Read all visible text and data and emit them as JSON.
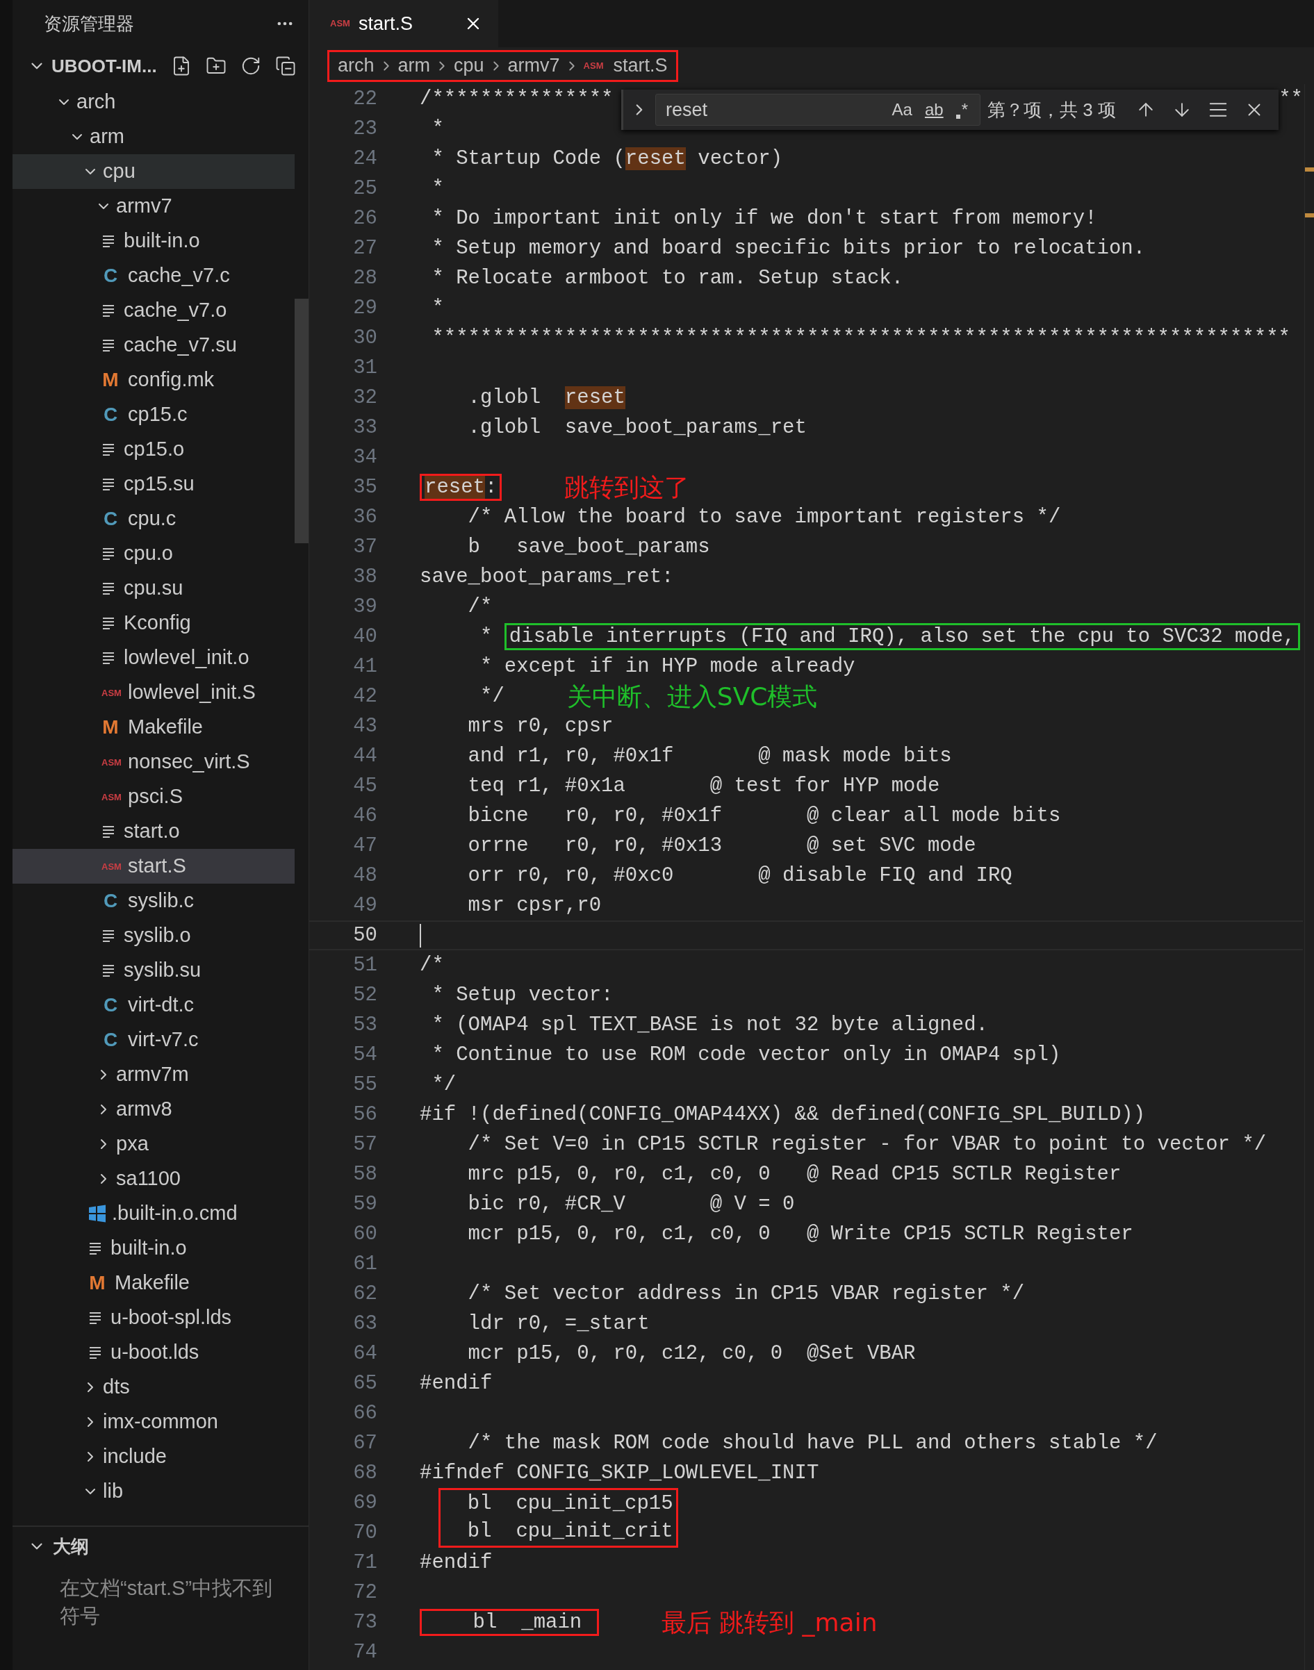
{
  "sidebar": {
    "title": "资源管理器",
    "root": {
      "name": "UBOOT-IM...",
      "expanded": true
    },
    "tree": [
      {
        "name": "arch",
        "kind": "folder",
        "expanded": true,
        "selected": false,
        "children": [
          {
            "name": "arm",
            "kind": "folder",
            "expanded": true,
            "selected": false,
            "children": [
              {
                "name": "cpu",
                "kind": "folder",
                "expanded": true,
                "selected": true,
                "children": [
                  {
                    "name": "armv7",
                    "kind": "folder",
                    "expanded": true,
                    "selected": false,
                    "children": [
                      {
                        "name": "built-in.o",
                        "kind": "text",
                        "selected": false
                      },
                      {
                        "name": "cache_v7.c",
                        "kind": "c",
                        "icon": "C",
                        "selected": false
                      },
                      {
                        "name": "cache_v7.o",
                        "kind": "text",
                        "selected": false
                      },
                      {
                        "name": "cache_v7.su",
                        "kind": "text",
                        "selected": false
                      },
                      {
                        "name": "config.mk",
                        "kind": "make",
                        "icon": "M",
                        "selected": false
                      },
                      {
                        "name": "cp15.c",
                        "kind": "c",
                        "icon": "C",
                        "selected": false
                      },
                      {
                        "name": "cp15.o",
                        "kind": "text",
                        "selected": false
                      },
                      {
                        "name": "cp15.su",
                        "kind": "text",
                        "selected": false
                      },
                      {
                        "name": "cpu.c",
                        "kind": "c",
                        "icon": "C",
                        "selected": false
                      },
                      {
                        "name": "cpu.o",
                        "kind": "text",
                        "selected": false
                      },
                      {
                        "name": "cpu.su",
                        "kind": "text",
                        "selected": false
                      },
                      {
                        "name": "Kconfig",
                        "kind": "text",
                        "selected": false
                      },
                      {
                        "name": "lowlevel_init.o",
                        "kind": "text",
                        "selected": false
                      },
                      {
                        "name": "lowlevel_init.S",
                        "kind": "asm",
                        "icon": "ASM",
                        "selected": false
                      },
                      {
                        "name": "Makefile",
                        "kind": "make",
                        "icon": "M",
                        "selected": false
                      },
                      {
                        "name": "nonsec_virt.S",
                        "kind": "asm",
                        "icon": "ASM",
                        "selected": false
                      },
                      {
                        "name": "psci.S",
                        "kind": "asm",
                        "icon": "ASM",
                        "selected": false
                      },
                      {
                        "name": "start.o",
                        "kind": "text",
                        "selected": false
                      },
                      {
                        "name": "start.S",
                        "kind": "asm",
                        "icon": "ASM",
                        "selected": true
                      },
                      {
                        "name": "syslib.c",
                        "kind": "c",
                        "icon": "C",
                        "selected": false
                      },
                      {
                        "name": "syslib.o",
                        "kind": "text",
                        "selected": false
                      },
                      {
                        "name": "syslib.su",
                        "kind": "text",
                        "selected": false
                      },
                      {
                        "name": "virt-dt.c",
                        "kind": "c",
                        "icon": "C",
                        "selected": false
                      },
                      {
                        "name": "virt-v7.c",
                        "kind": "c",
                        "icon": "C",
                        "selected": false
                      }
                    ]
                  },
                  {
                    "name": "armv7m",
                    "kind": "folder",
                    "expanded": false,
                    "selected": false
                  },
                  {
                    "name": "armv8",
                    "kind": "folder",
                    "expanded": false,
                    "selected": false
                  },
                  {
                    "name": "pxa",
                    "kind": "folder",
                    "expanded": false,
                    "selected": false
                  },
                  {
                    "name": "sa1100",
                    "kind": "folder",
                    "expanded": false,
                    "selected": false
                  },
                  {
                    "name": ".built-in.o.cmd",
                    "kind": "windows",
                    "selected": false
                  },
                  {
                    "name": "built-in.o",
                    "kind": "text",
                    "selected": false
                  },
                  {
                    "name": "Makefile",
                    "kind": "make",
                    "icon": "M",
                    "selected": false
                  },
                  {
                    "name": "u-boot-spl.lds",
                    "kind": "text",
                    "selected": false
                  },
                  {
                    "name": "u-boot.lds",
                    "kind": "text",
                    "selected": false
                  }
                ]
              },
              {
                "name": "dts",
                "kind": "folder",
                "expanded": false,
                "selected": false
              },
              {
                "name": "imx-common",
                "kind": "folder",
                "expanded": false,
                "selected": false
              },
              {
                "name": "include",
                "kind": "folder",
                "expanded": false,
                "selected": false
              },
              {
                "name": "lib",
                "kind": "folder",
                "expanded": true,
                "selected": false
              }
            ]
          }
        ]
      }
    ],
    "outline": {
      "title": "大纲",
      "expanded": true,
      "message": "在文档“start.S”中找不到符号"
    }
  },
  "tabs": [
    {
      "title": "start.S",
      "icon": "ASM",
      "selected": true
    }
  ],
  "breadcrumb": {
    "color": "#f21b1b",
    "items": [
      {
        "text": "arch"
      },
      {
        "text": "arm"
      },
      {
        "text": "cpu"
      },
      {
        "text": "armv7"
      },
      {
        "text": "start.S",
        "icon": "ASM"
      }
    ]
  },
  "find": {
    "query": "reset",
    "options": [
      {
        "label": "Aa",
        "kind": "case",
        "on": false
      },
      {
        "label": "ab",
        "kind": "word",
        "on": false
      },
      {
        "label": "*",
        "kind": "regex",
        "on": false
      }
    ],
    "result": "第？项，共 3 项"
  },
  "code": [
    {
      "number": "22",
      "current": false,
      "segments": [
        {
          "kind": "text",
          "text": "/***************"
        }
      ],
      "tail": "**"
    },
    {
      "number": "23",
      "current": false,
      "segments": [
        {
          "kind": "text",
          "text": " *"
        }
      ]
    },
    {
      "number": "24",
      "current": false,
      "segments": [
        {
          "kind": "text",
          "text": " * Startup Code ("
        },
        {
          "kind": "match",
          "text": "reset"
        },
        {
          "kind": "text",
          "text": " vector)"
        }
      ]
    },
    {
      "number": "25",
      "current": false,
      "segments": [
        {
          "kind": "text",
          "text": " *"
        }
      ]
    },
    {
      "number": "26",
      "current": false,
      "segments": [
        {
          "kind": "text",
          "text": " * Do important init only if we don't start from memory!"
        }
      ]
    },
    {
      "number": "27",
      "current": false,
      "segments": [
        {
          "kind": "text",
          "text": " * Setup memory and board specific bits prior to relocation."
        }
      ]
    },
    {
      "number": "28",
      "current": false,
      "segments": [
        {
          "kind": "text",
          "text": " * Relocate armboot to ram. Setup stack."
        }
      ]
    },
    {
      "number": "29",
      "current": false,
      "segments": [
        {
          "kind": "text",
          "text": " *"
        }
      ]
    },
    {
      "number": "30",
      "current": false,
      "segments": [
        {
          "kind": "text",
          "text": " ***********************************************************************"
        }
      ]
    },
    {
      "number": "31",
      "current": false
    },
    {
      "number": "32",
      "current": false,
      "segments": [
        {
          "kind": "text",
          "text": "    .globl  "
        },
        {
          "kind": "match",
          "text": "reset"
        }
      ]
    },
    {
      "number": "33",
      "current": false,
      "segments": [
        {
          "kind": "text",
          "text": "    .globl  save_boot_params_ret"
        }
      ]
    },
    {
      "number": "34",
      "current": false
    },
    {
      "number": "35",
      "current": false,
      "segments": [
        {
          "kind": "box",
          "color": "#f21b1b",
          "segments": [
            {
              "kind": "match",
              "text": "reset"
            },
            {
              "kind": "text",
              "text": ":"
            }
          ]
        }
      ],
      "note": {
        "text": "跳转到这了",
        "color": "#f21b1b"
      }
    },
    {
      "number": "36",
      "current": false,
      "segments": [
        {
          "kind": "text",
          "text": "    /* Allow the board to save important registers */"
        }
      ]
    },
    {
      "number": "37",
      "current": false,
      "segments": [
        {
          "kind": "text",
          "text": "    b   save_boot_params"
        }
      ]
    },
    {
      "number": "38",
      "current": false,
      "segments": [
        {
          "kind": "text",
          "text": "save_boot_params_ret:"
        }
      ]
    },
    {
      "number": "39",
      "current": false,
      "segments": [
        {
          "kind": "text",
          "text": "    /*"
        }
      ]
    },
    {
      "number": "40",
      "current": false,
      "segments": [
        {
          "kind": "text",
          "text": "     * "
        },
        {
          "kind": "box",
          "color": "#1fbf2a",
          "segments": [
            {
              "kind": "text",
              "text": "disable interrupts (FIQ and IRQ), also set the cpu to SVC32 mode,"
            }
          ]
        }
      ]
    },
    {
      "number": "41",
      "current": false,
      "segments": [
        {
          "kind": "text",
          "text": "     * except if in HYP mode already"
        }
      ]
    },
    {
      "number": "42",
      "current": false,
      "segments": [
        {
          "kind": "text",
          "text": "     */"
        }
      ],
      "note": {
        "text": "关中断、进入SVC模式",
        "color": "#1fbf2a"
      }
    },
    {
      "number": "43",
      "current": false,
      "segments": [
        {
          "kind": "text",
          "text": "    mrs r0, cpsr"
        }
      ]
    },
    {
      "number": "44",
      "current": false,
      "segments": [
        {
          "kind": "text",
          "text": "    and r1, r0, #0x1f       @ mask mode bits"
        }
      ]
    },
    {
      "number": "45",
      "current": false,
      "segments": [
        {
          "kind": "text",
          "text": "    teq r1, #0x1a       @ test for HYP mode"
        }
      ]
    },
    {
      "number": "46",
      "current": false,
      "segments": [
        {
          "kind": "text",
          "text": "    bicne   r0, r0, #0x1f       @ clear all mode bits"
        }
      ]
    },
    {
      "number": "47",
      "current": false,
      "segments": [
        {
          "kind": "text",
          "text": "    orrne   r0, r0, #0x13       @ set SVC mode"
        }
      ]
    },
    {
      "number": "48",
      "current": false,
      "segments": [
        {
          "kind": "text",
          "text": "    orr r0, r0, #0xc0       @ disable FIQ and IRQ"
        }
      ]
    },
    {
      "number": "49",
      "current": false,
      "segments": [
        {
          "kind": "text",
          "text": "    msr cpsr,r0"
        }
      ]
    },
    {
      "number": "50",
      "current": true
    },
    {
      "number": "51",
      "current": false,
      "segments": [
        {
          "kind": "text",
          "text": "/*"
        }
      ]
    },
    {
      "number": "52",
      "current": false,
      "segments": [
        {
          "kind": "text",
          "text": " * Setup vector:"
        }
      ]
    },
    {
      "number": "53",
      "current": false,
      "segments": [
        {
          "kind": "text",
          "text": " * (OMAP4 spl TEXT_BASE is not 32 byte aligned."
        }
      ]
    },
    {
      "number": "54",
      "current": false,
      "segments": [
        {
          "kind": "text",
          "text": " * Continue to use ROM code vector only in OMAP4 spl)"
        }
      ]
    },
    {
      "number": "55",
      "current": false,
      "segments": [
        {
          "kind": "text",
          "text": " */"
        }
      ]
    },
    {
      "number": "56",
      "current": false,
      "segments": [
        {
          "kind": "text",
          "text": "#if !(defined(CONFIG_OMAP44XX) && defined(CONFIG_SPL_BUILD))"
        }
      ]
    },
    {
      "number": "57",
      "current": false,
      "segments": [
        {
          "kind": "text",
          "text": "    /* Set V=0 in CP15 SCTLR register - for VBAR to point to vector */"
        }
      ]
    },
    {
      "number": "58",
      "current": false,
      "segments": [
        {
          "kind": "text",
          "text": "    mrc p15, 0, r0, c1, c0, 0   @ Read CP15 SCTLR Register"
        }
      ]
    },
    {
      "number": "59",
      "current": false,
      "segments": [
        {
          "kind": "text",
          "text": "    bic r0, #CR_V       @ V = 0"
        }
      ]
    },
    {
      "number": "60",
      "current": false,
      "segments": [
        {
          "kind": "text",
          "text": "    mcr p15, 0, r0, c1, c0, 0   @ Write CP15 SCTLR Register"
        }
      ]
    },
    {
      "number": "61",
      "current": false
    },
    {
      "number": "62",
      "current": false,
      "segments": [
        {
          "kind": "text",
          "text": "    /* Set vector address in CP15 VBAR register */"
        }
      ]
    },
    {
      "number": "63",
      "current": false,
      "segments": [
        {
          "kind": "text",
          "text": "    ldr r0, =_start"
        }
      ]
    },
    {
      "number": "64",
      "current": false,
      "segments": [
        {
          "kind": "text",
          "text": "    mcr p15, 0, r0, c12, c0, 0  @Set VBAR"
        }
      ]
    },
    {
      "number": "65",
      "current": false,
      "segments": [
        {
          "kind": "text",
          "text": "#endif"
        }
      ]
    },
    {
      "number": "66",
      "current": false
    },
    {
      "number": "67",
      "current": false,
      "segments": [
        {
          "kind": "text",
          "text": "    /* the mask ROM code should have PLL and others stable */"
        }
      ]
    },
    {
      "number": "68",
      "current": false,
      "segments": [
        {
          "kind": "text",
          "text": "#ifndef CONFIG_SKIP_LOWLEVEL_INIT"
        }
      ]
    },
    {
      "kind": "box",
      "color": "#f21b1b",
      "lines": [
        {
          "number": "69",
          "current": false,
          "segments": [
            {
              "kind": "text",
              "text": "  bl  cpu_init_cp15"
            }
          ]
        },
        {
          "number": "70",
          "current": false,
          "segments": [
            {
              "kind": "text",
              "text": "  bl  cpu_init_crit"
            }
          ]
        }
      ]
    },
    {
      "number": "71",
      "current": false,
      "segments": [
        {
          "kind": "text",
          "text": "#endif"
        }
      ]
    },
    {
      "number": "72",
      "current": false
    },
    {
      "number": "73",
      "current": false,
      "segments": [
        {
          "kind": "box",
          "color": "#f21b1b",
          "segments": [
            {
              "kind": "text",
              "text": "    bl  _main "
            }
          ]
        }
      ],
      "note": {
        "text": "最后  跳转到  _main",
        "color": "#f21b1b"
      }
    },
    {
      "number": "74",
      "current": false
    }
  ]
}
